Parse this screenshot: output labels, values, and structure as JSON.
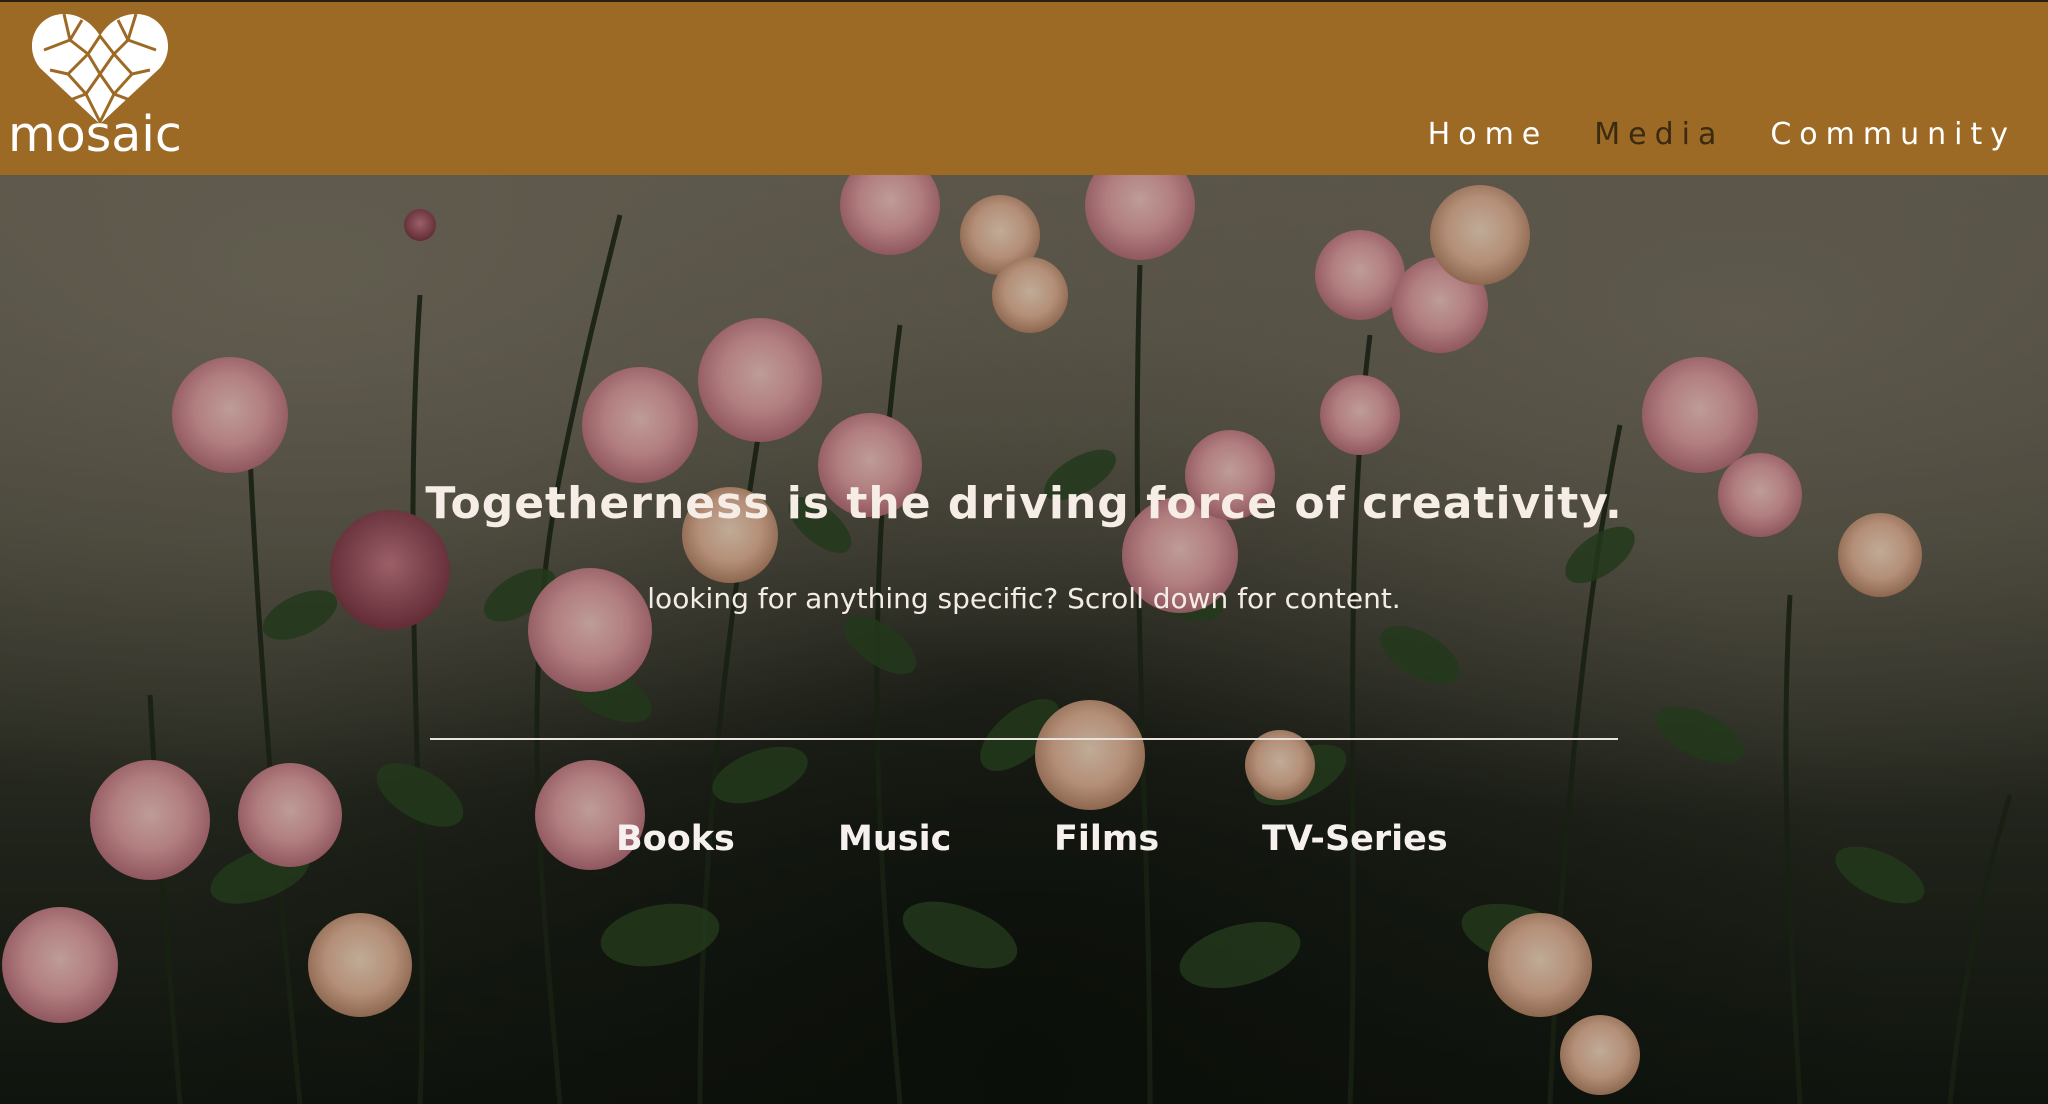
{
  "brand": {
    "name": "mosaic",
    "logo_icon": "mosaic-heart-icon"
  },
  "nav": {
    "items": [
      {
        "label": "Home",
        "active": false
      },
      {
        "label": "Media",
        "active": true
      },
      {
        "label": "Community",
        "active": false
      }
    ]
  },
  "hero": {
    "tagline": "Togetherness is the driving force of creativity.",
    "subline": "looking for anything specific? Scroll down for content.",
    "categories": [
      {
        "label": "Books"
      },
      {
        "label": "Music"
      },
      {
        "label": "Films"
      },
      {
        "label": "TV-Series"
      }
    ],
    "background": "pink roses photo"
  },
  "colors": {
    "header_bg": "#9c6a24",
    "active_nav": "#3b2a12",
    "text_light": "#ffffff"
  }
}
